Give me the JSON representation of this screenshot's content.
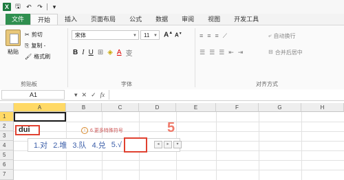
{
  "qat": {
    "app_glyph": "X",
    "save_glyph": "🖫",
    "undo_glyph": "↶",
    "redo_glyph": "↷",
    "more_glyph": "▾"
  },
  "tabs": [
    "文件",
    "开始",
    "插入",
    "页面布局",
    "公式",
    "数据",
    "审阅",
    "视图",
    "开发工具"
  ],
  "clipboard": {
    "paste": "粘贴",
    "cut": "剪切",
    "copy": "复制 -",
    "format_painter": "格式刷",
    "label": "剪贴板"
  },
  "font": {
    "name": "宋体",
    "size": "11",
    "bold": "B",
    "italic": "I",
    "underline": "U",
    "grow": "A",
    "shrink": "A",
    "label": "字体"
  },
  "alignment": {
    "wrap": "自动换行",
    "merge": "合并后居中",
    "label": "对齐方式"
  },
  "formula_bar": {
    "name_box": "A1",
    "fx": "fx"
  },
  "columns": [
    "A",
    "B",
    "C",
    "D",
    "E",
    "F",
    "G",
    "H"
  ],
  "rows": [
    "1",
    "2",
    "3",
    "4",
    "5",
    "6",
    "7"
  ],
  "ime": {
    "input": "dui",
    "tip": "6.更多特殊符号",
    "candidates": [
      "1.对",
      "2.堆",
      "3.队",
      "4.兑",
      "5.√"
    ],
    "step_marker": "5"
  }
}
